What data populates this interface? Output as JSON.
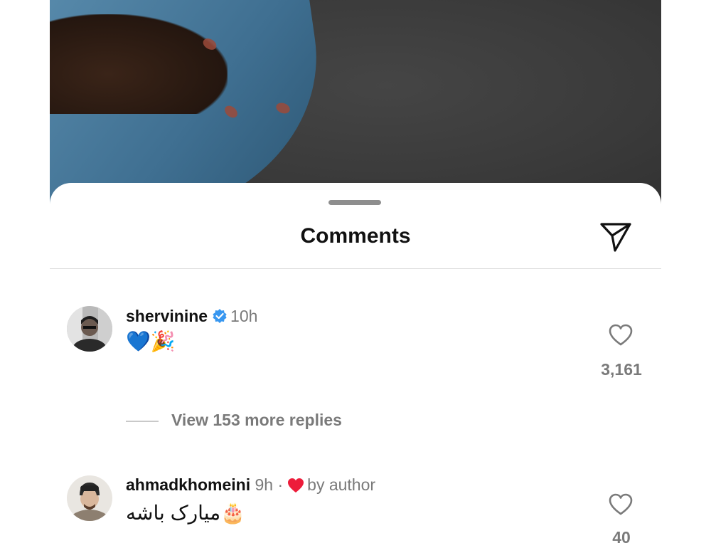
{
  "header": {
    "title": "Comments"
  },
  "comments": [
    {
      "username": "shervinine",
      "verified": true,
      "time": "10h",
      "text": "💙🎉",
      "likes": "3,161",
      "replies_label": "View 153 more replies"
    },
    {
      "username": "ahmadkhomeini",
      "verified": false,
      "time": "9h",
      "separator": "·",
      "liked_by_author_label": "by author",
      "text": "میارک باشه🎂",
      "likes": "40"
    }
  ],
  "colors": {
    "verified_blue": "#3897f0",
    "author_heart": "#ed1c3a"
  },
  "icons": [
    "send-icon",
    "verified-badge-icon",
    "heart-outline-icon",
    "heart-filled-icon"
  ]
}
